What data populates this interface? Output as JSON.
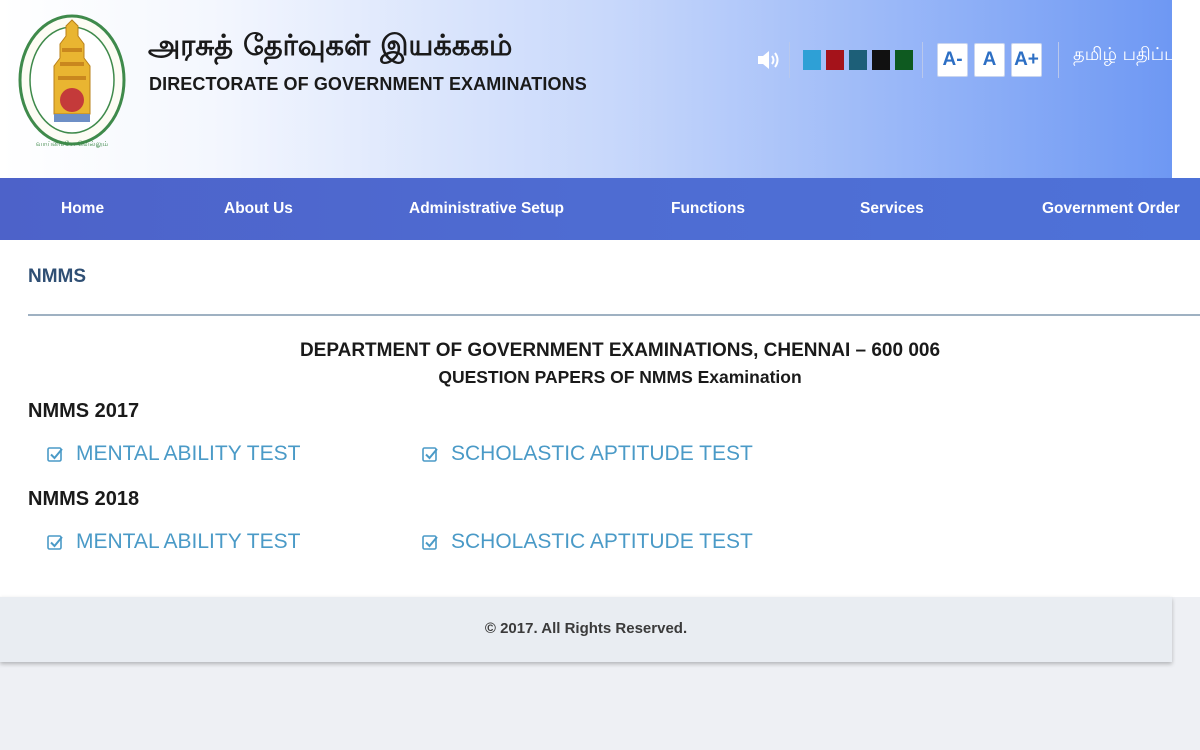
{
  "header": {
    "title_ta": "அரசுத் தேர்வுகள் இயக்ககம்",
    "title_en": "DIRECTORATE OF GOVERNMENT EXAMINATIONS",
    "emblem_text": "வாய்மையே வெல்லும்",
    "speaker_icon": "speaker-icon",
    "theme_colors": [
      "#2ea0d6",
      "#a4121a",
      "#1d5f78",
      "#111111",
      "#0e5a20"
    ],
    "font_buttons": [
      "A-",
      "A",
      "A+"
    ],
    "language_link": "தமிழ் பதிப்பு"
  },
  "nav": {
    "items": [
      "Home",
      "About Us",
      "Administrative Setup",
      "Functions",
      "Services",
      "Government Order"
    ]
  },
  "content": {
    "section_title": "NMMS",
    "department": "DEPARTMENT OF GOVERNMENT EXAMINATIONS, CHENNAI – 600 006",
    "subtitle": "QUESTION PAPERS OF NMMS Examination",
    "years": [
      {
        "label": "NMMS 2017",
        "links": [
          "MENTAL ABILITY TEST",
          "SCHOLASTIC APTITUDE TEST"
        ]
      },
      {
        "label": "NMMS 2018",
        "links": [
          "MENTAL ABILITY TEST",
          "SCHOLASTIC APTITUDE TEST"
        ]
      }
    ],
    "link_icon": "checkbox-icon"
  },
  "footer": {
    "copyright": "© 2017. All Rights Reserved."
  }
}
